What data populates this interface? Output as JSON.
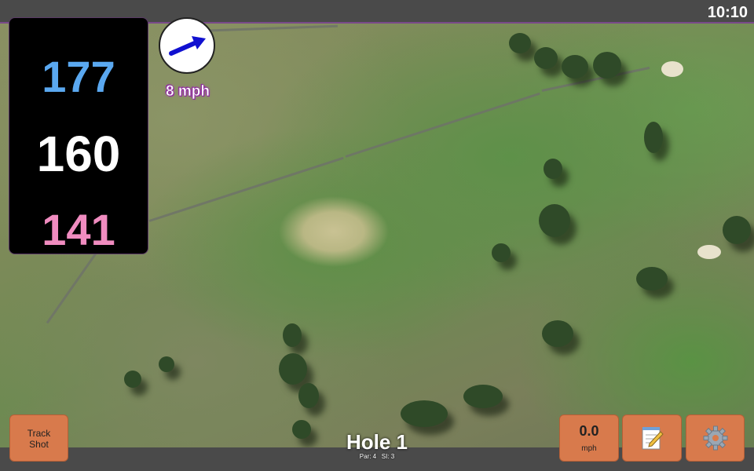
{
  "status": {
    "time": "10:10"
  },
  "distances": {
    "back": "177",
    "middle": "160",
    "front": "141"
  },
  "wind": {
    "speed": "8 mph",
    "icon": "wind-arrow-icon"
  },
  "buttons": {
    "track_shot_line1": "Track",
    "track_shot_line2": "Shot",
    "speed_value": "0.0",
    "speed_unit": "mph",
    "notes_icon": "notepad-icon",
    "settings_icon": "gear-icon"
  },
  "hole": {
    "title": "Hole 1",
    "par": "Par: 4",
    "si": "SI: 3"
  },
  "colors": {
    "back": "#5aa8f0",
    "middle": "#ffffff",
    "front": "#f08cc0",
    "button": "#d87a4c",
    "accent": "#7a4a8a"
  }
}
